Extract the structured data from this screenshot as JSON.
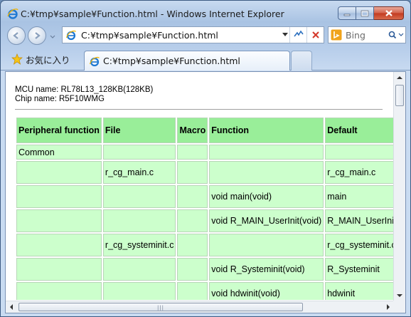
{
  "window": {
    "title": "C:¥tmp¥sample¥Function.html - Windows Internet Explorer"
  },
  "navbar": {
    "address": "C:¥tmp¥sample¥Function.html",
    "search_placeholder": "Bing"
  },
  "tabs": {
    "favorites_label": "お気に入り",
    "active_tab_label": "C:¥tmp¥sample¥Function.html"
  },
  "page": {
    "mcu_line": "MCU name: RL78L13_128KB(128KB)",
    "chip_line": "Chip name: R5F10WMG",
    "table": {
      "headers": [
        "Peripheral function",
        "File",
        "Macro",
        "Function",
        "Default"
      ],
      "rows": [
        [
          "Common",
          "",
          "",
          "",
          ""
        ],
        [
          "",
          "r_cg_main.c",
          "",
          "",
          "r_cg_main.c"
        ],
        [
          "",
          "",
          "",
          "void main(void)",
          "main"
        ],
        [
          "",
          "",
          "",
          "void R_MAIN_UserInit(void)",
          "R_MAIN_UserInit"
        ],
        [
          "",
          "r_cg_systeminit.c",
          "",
          "",
          "r_cg_systeminit.c"
        ],
        [
          "",
          "",
          "",
          "void R_Systeminit(void)",
          "R_Systeminit"
        ],
        [
          "",
          "",
          "",
          "void hdwinit(void)",
          "hdwinit"
        ]
      ]
    }
  },
  "colors": {
    "header_bg": "#99ee99",
    "cell_bg": "#ccffcc"
  }
}
